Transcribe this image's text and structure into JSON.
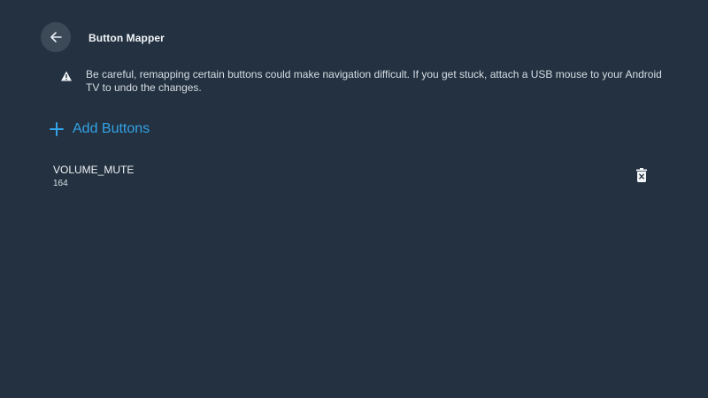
{
  "header": {
    "back_icon": "arrow-left-icon",
    "title": "Button Mapper"
  },
  "warning": {
    "icon": "warning-icon",
    "text": "Be careful, remapping certain buttons could make navigation difficult. If you get stuck, attach a USB mouse to your Android TV to undo the changes."
  },
  "add_buttons": {
    "icon": "plus-icon",
    "label": "Add Buttons",
    "color": "#34a3e7"
  },
  "mappings": [
    {
      "name": "VOLUME_MUTE",
      "code": "164",
      "action_icon": "delete-icon"
    }
  ],
  "colors": {
    "background": "#233140",
    "accent": "#34a3e7"
  }
}
